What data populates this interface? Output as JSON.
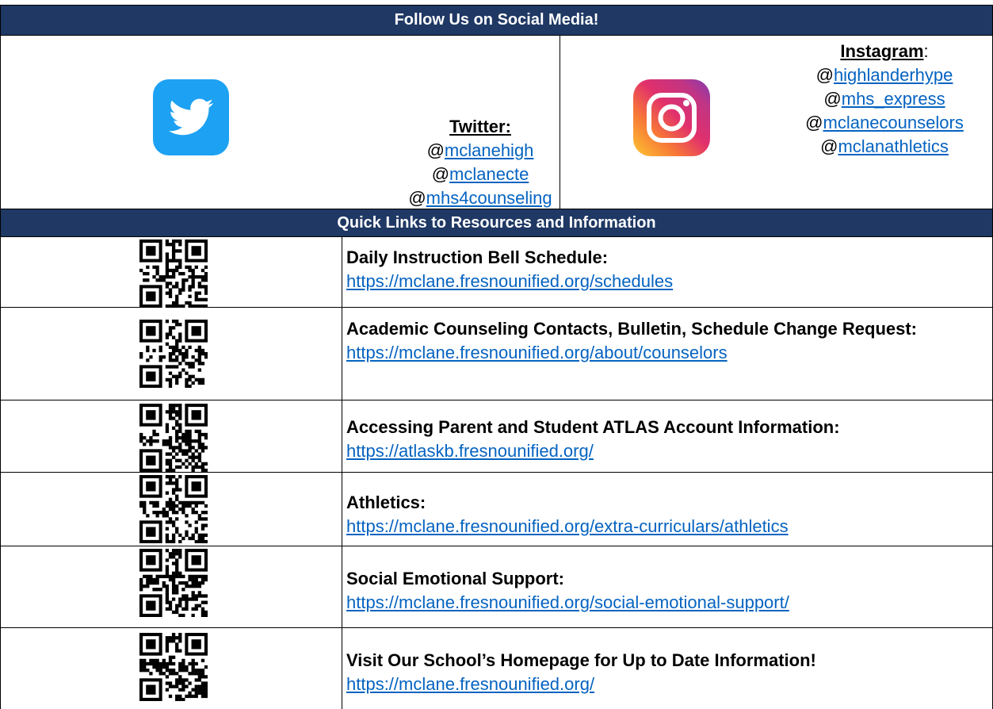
{
  "social": {
    "header": "Follow Us on Social Media!",
    "twitter": {
      "icon": "twitter-bird-icon",
      "color": "#1da1f2",
      "title": "Twitter:",
      "handles": [
        {
          "at": "@",
          "name": "mclanehigh"
        },
        {
          "at": "@",
          "name": "mclanecte"
        },
        {
          "at": "@",
          "name": "mhs4counseling"
        }
      ]
    },
    "instagram": {
      "icon": "instagram-camera-icon",
      "title": "Instagram",
      "title_suffix": ":",
      "handles": [
        {
          "at": "@",
          "name": "highlanderhype"
        },
        {
          "at": "@",
          "name": "mhs_express"
        },
        {
          "at": "@",
          "name": "mclanecounselors"
        },
        {
          "at": "@",
          "name": "mclanathletics"
        }
      ]
    }
  },
  "links": {
    "header": "Quick Links to Resources and Information",
    "header_color": "#1f3864",
    "link_color": "#0563c1",
    "rows": [
      {
        "label": "Daily Instruction Bell Schedule:",
        "url": "https://mclane.fresnounified.org/schedules"
      },
      {
        "label": "Academic Counseling Contacts, Bulletin, Schedule Change Request:",
        "url": "https://mclane.fresnounified.org/about/counselors"
      },
      {
        "label": "Accessing Parent and Student ATLAS Account Information:",
        "url": "https://atlaskb.fresnounified.org/"
      },
      {
        "label": "Athletics:",
        "url": "https://mclane.fresnounified.org/extra-curriculars/athletics"
      },
      {
        "label": "Social Emotional Support:",
        "url": "https://mclane.fresnounified.org/social-emotional-support/"
      },
      {
        "label": "Visit Our School’s Homepage for Up to Date Information!",
        "url": "https://mclane.fresnounified.org/"
      }
    ]
  }
}
